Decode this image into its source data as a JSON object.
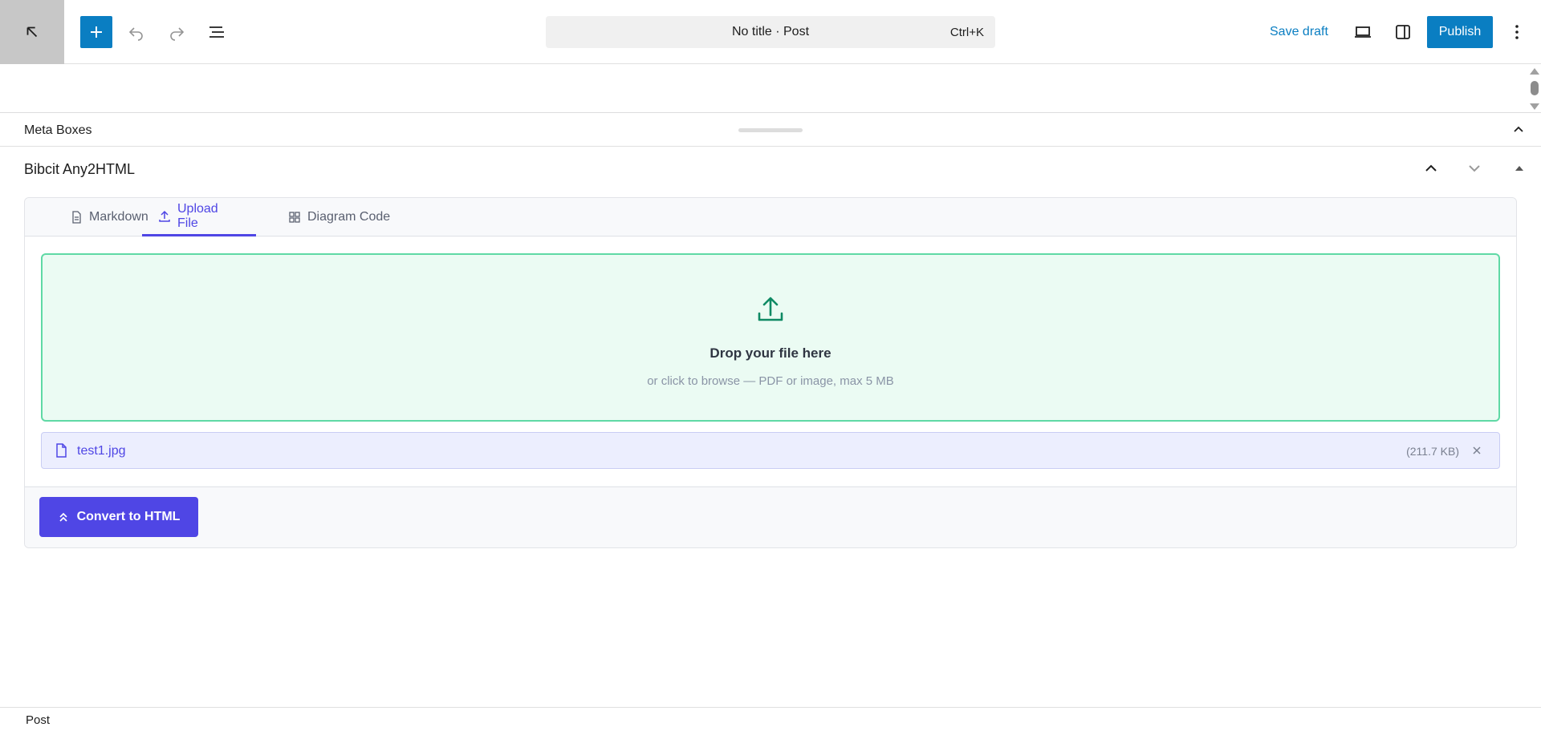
{
  "toolbar": {
    "command_bar_text": "No title · Post",
    "command_shortcut": "Ctrl+K",
    "save_draft_label": "Save draft",
    "publish_label": "Publish",
    "icons": [
      "wordpress-back-icon",
      "plus-icon",
      "undo-icon",
      "redo-icon",
      "list-view-icon",
      "preview-icon",
      "settings-sidebar-icon",
      "more-options-icon"
    ]
  },
  "meta_boxes": {
    "title": "Meta Boxes"
  },
  "panel": {
    "title": "Bibcit Any2HTML"
  },
  "tabs": [
    {
      "label": "Markdown",
      "icon": "document-icon",
      "active": false
    },
    {
      "label": "Upload File",
      "icon": "upload-icon",
      "active": true
    },
    {
      "label": "Diagram Code",
      "icon": "grid-icon",
      "active": false
    }
  ],
  "dropzone": {
    "title": "Drop your file here",
    "subtitle": "or click to browse — PDF or image, max 5 MB"
  },
  "file": {
    "name": "test1.jpg",
    "size": "(211.7 KB)"
  },
  "convert_label": "Convert to HTML",
  "footer": {
    "breadcrumb": "Post"
  },
  "colors": {
    "wp_blue": "#0a7ec2",
    "accent": "#4f46e5",
    "dropzone_border": "#5fd9a5",
    "dropzone_bg": "#ebfbf3"
  }
}
